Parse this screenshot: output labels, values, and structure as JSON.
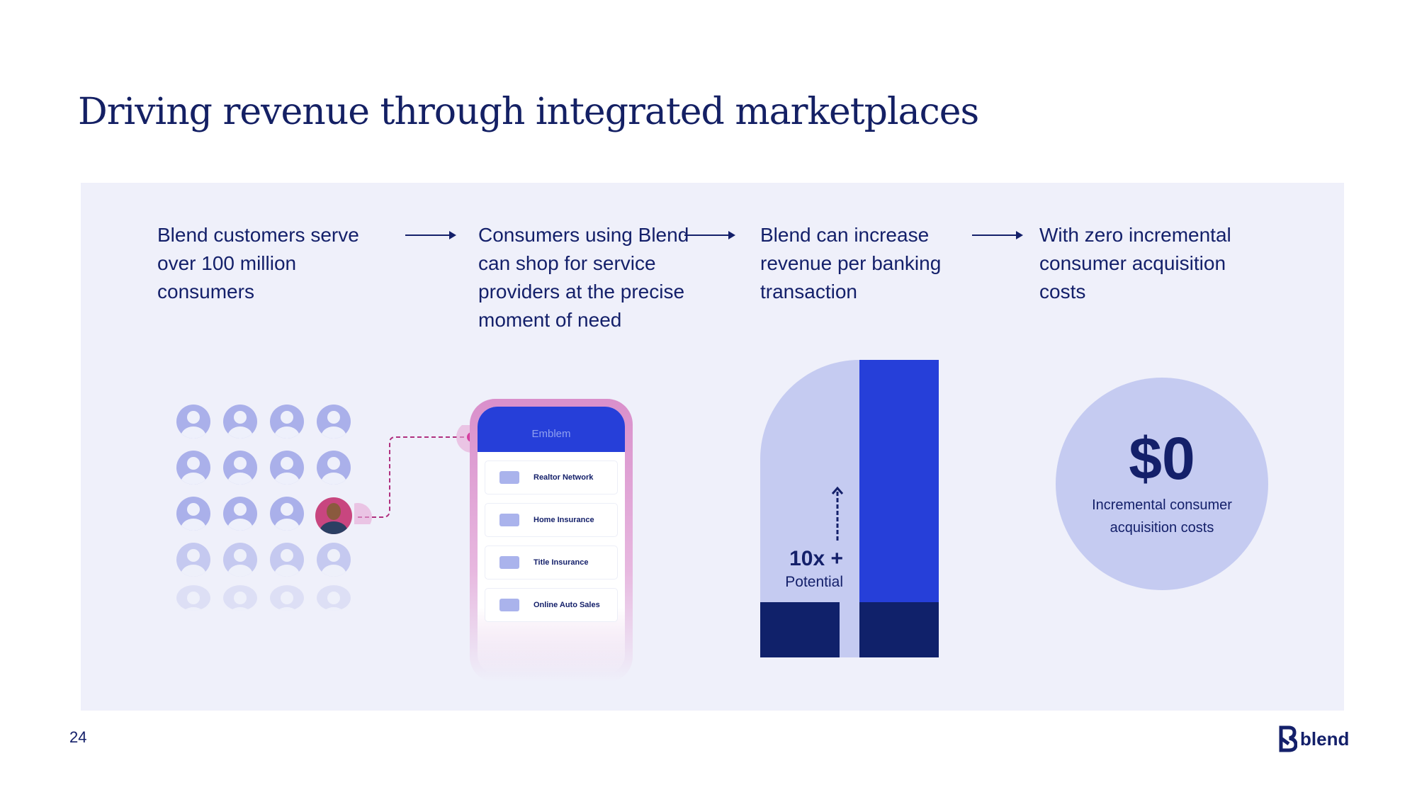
{
  "title": "Driving revenue through integrated marketplaces",
  "steps": [
    "Blend customers serve over 100 million consumers",
    "Consumers using Blend can shop for service providers at the precise moment of need",
    "Blend can increase revenue per banking transaction",
    "With zero incremental consumer acquisition costs"
  ],
  "phone": {
    "brand": "Emblem",
    "items": [
      "Realtor Network",
      "Home Insurance",
      "Title Insurance",
      "Online Auto Sales"
    ]
  },
  "bars": {
    "multiplier": "10x +",
    "label": "Potential"
  },
  "zero": {
    "value": "$0",
    "label": "Incremental consumer acquisition costs"
  },
  "page_number": "24",
  "logo": "blend",
  "colors": {
    "navy": "#14206a",
    "blue": "#263fd9",
    "lavender": "#c5cbf1",
    "panel": "#eff0fa",
    "pink": "#d63fa0"
  }
}
